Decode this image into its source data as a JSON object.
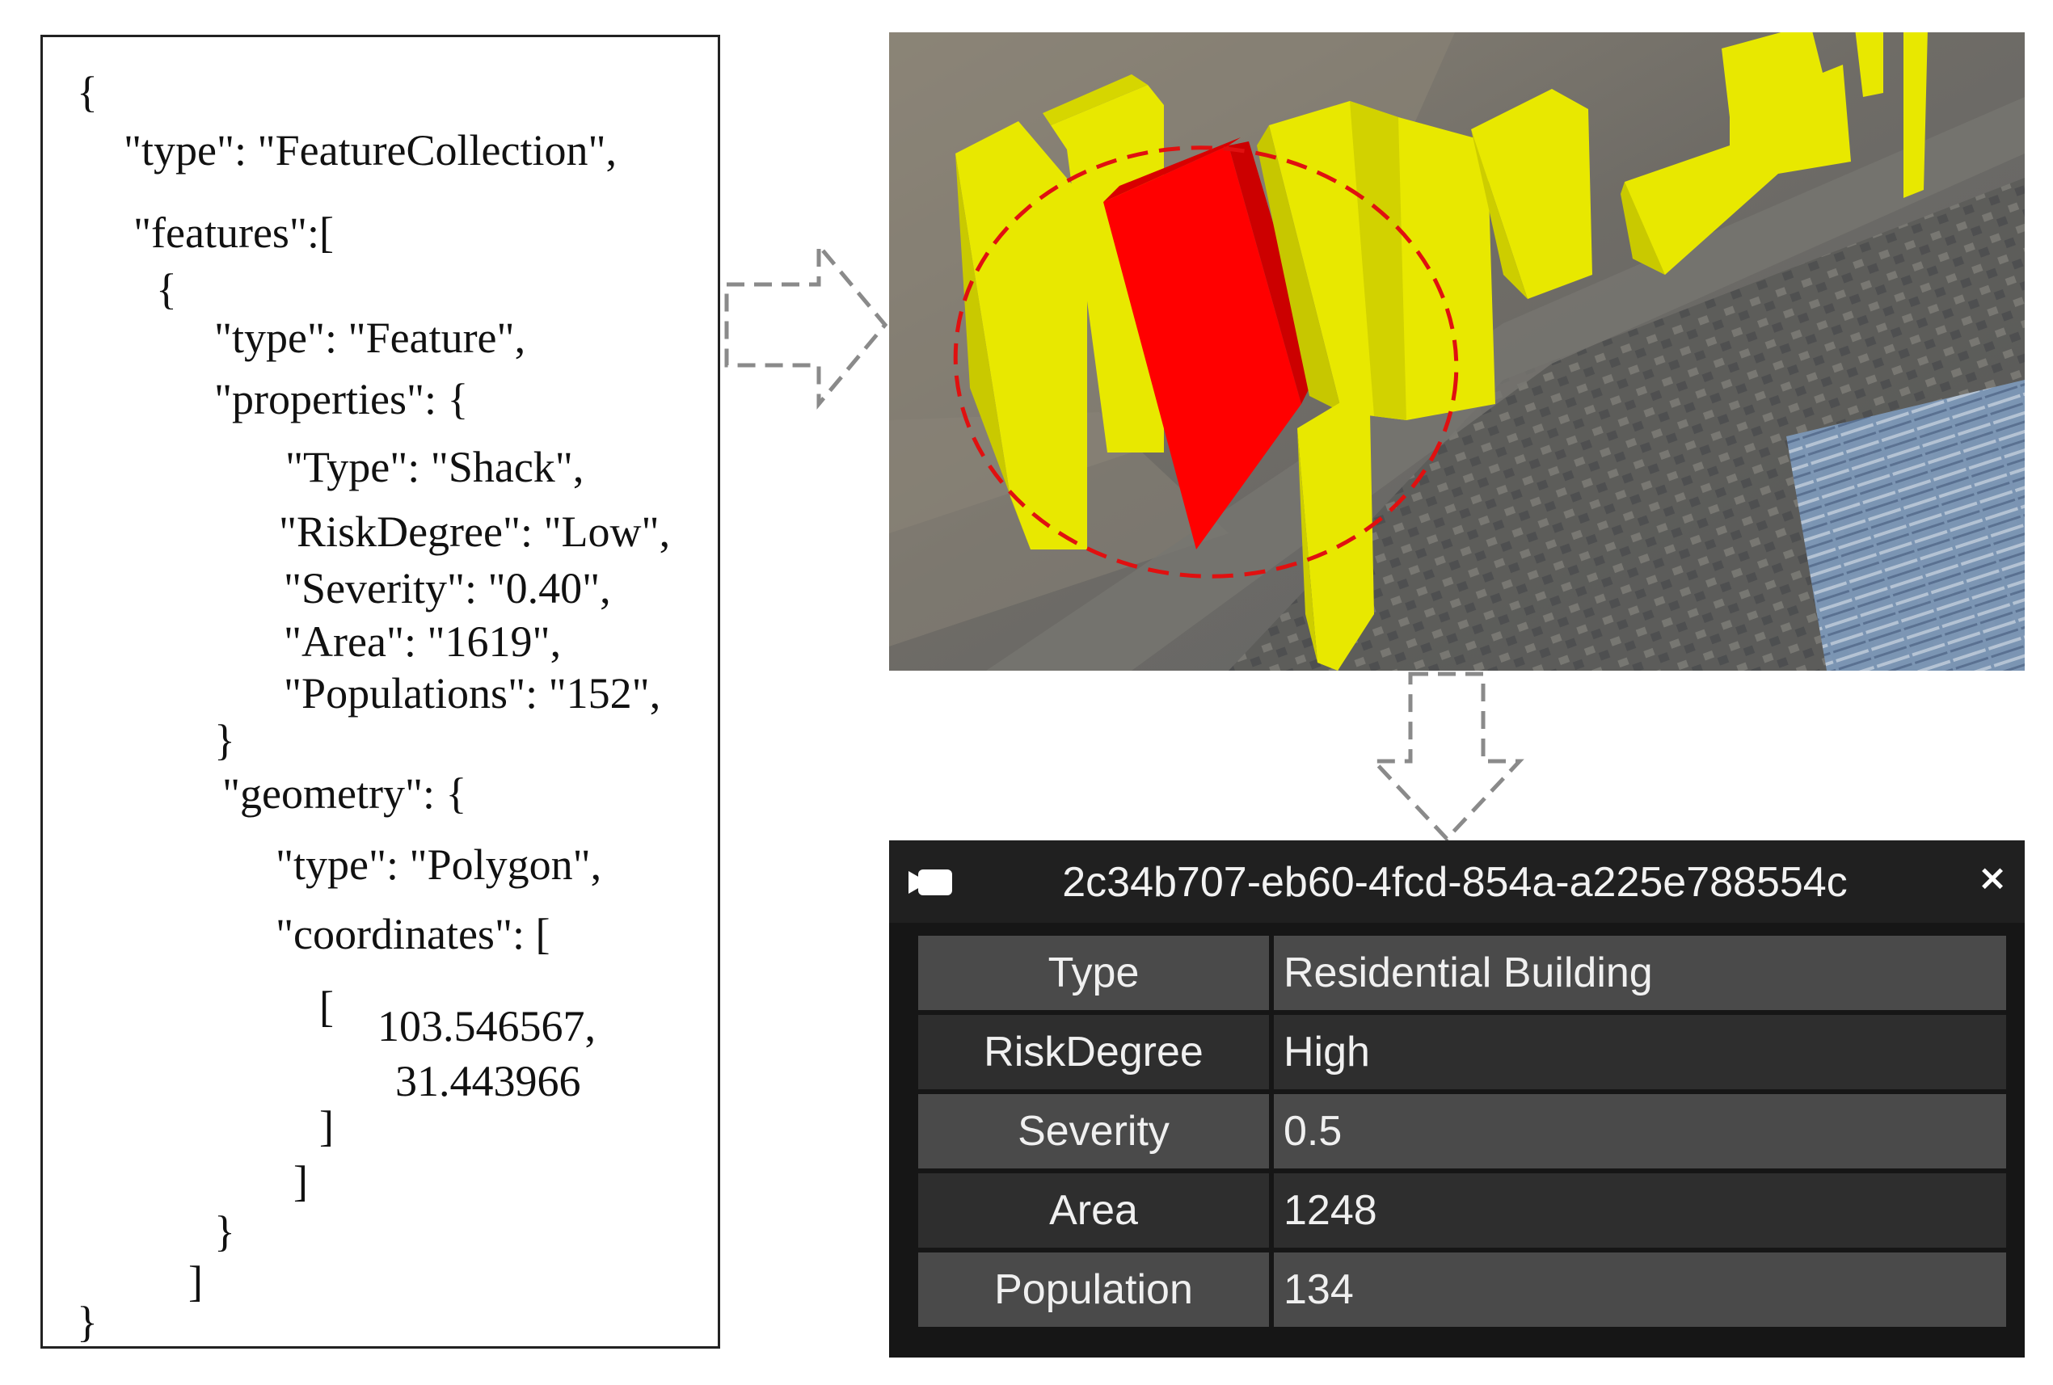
{
  "code_panel": {
    "lines": [
      "{",
      "\"type\": \"FeatureCollection\",",
      "\"features\":[",
      "{",
      "\"type\": \"Feature\",",
      "\"properties\": {",
      "\"Type\": \"Shack\",",
      "\"RiskDegree\": \"Low\",",
      "\"Severity\": \"0.40\",",
      "\"Area\": \"1619\",",
      "\"Populations\": \"152\",",
      "}",
      "\"geometry\": {",
      "\"type\": \"Polygon\",",
      "\"coordinates\": [",
      "[",
      "103.546567,",
      "31.443966",
      "]",
      "]",
      "}",
      "]",
      "}"
    ]
  },
  "scene": {
    "building_colors": {
      "normal": "#e4e400",
      "highlighted": "#ff0000",
      "highlight_ring": "#e01010"
    }
  },
  "popup": {
    "title": "2c34b707-eb60-4fcd-854a-a225e788554c",
    "camera_icon": "camera-icon",
    "close_label": "×",
    "rows": [
      {
        "key": "Type",
        "value": "Residential Building"
      },
      {
        "key": "RiskDegree",
        "value": "High"
      },
      {
        "key": "Severity",
        "value": "0.5"
      },
      {
        "key": "Area",
        "value": "1248"
      },
      {
        "key": "Population",
        "value": "134"
      }
    ]
  }
}
